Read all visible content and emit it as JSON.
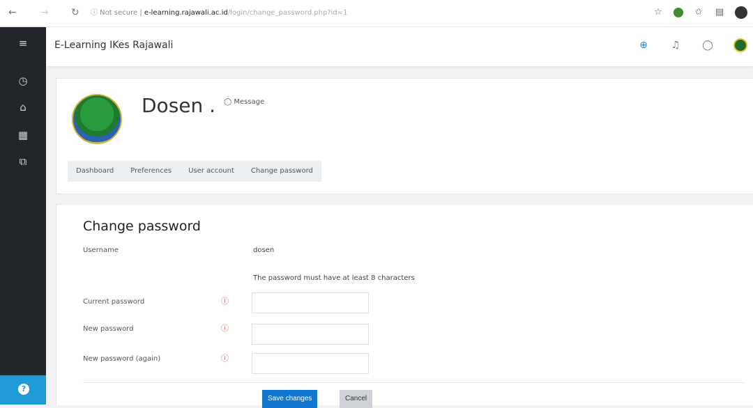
{
  "browser": {
    "back": "←",
    "forward": "→",
    "reload": "↻",
    "url_prefix": "ⓘ Not secure",
    "url_host": "e-learning.rajawali.ac.id",
    "url_path": "/login/change_password.php?id=1"
  },
  "header": {
    "site_title": "E-Learning IKes Rajawali"
  },
  "profile": {
    "name": "Dosen .",
    "message_link": "Message",
    "tabs": [
      "Dashboard",
      "Preferences",
      "User account",
      "Change password"
    ]
  },
  "form": {
    "title": "Change password",
    "username_label": "Username",
    "username_value": "dosen",
    "password_rule": "The password must have at least 8 characters",
    "current_password_label": "Current password",
    "new_password_label": "New password",
    "new_password_again_label": "New password (again)",
    "save_label": "Save changes",
    "cancel_label": "Cancel"
  },
  "colors": {
    "sidebar": "#22252a",
    "primary": "#1177d1",
    "required": "#d9534f",
    "help": "#1f9bd7"
  },
  "icons": {
    "menu": "menu-icon",
    "dashboard": "dashboard-icon",
    "home": "home-icon",
    "calendar": "calendar-icon",
    "courses": "courses-icon",
    "required": "required-icon"
  }
}
